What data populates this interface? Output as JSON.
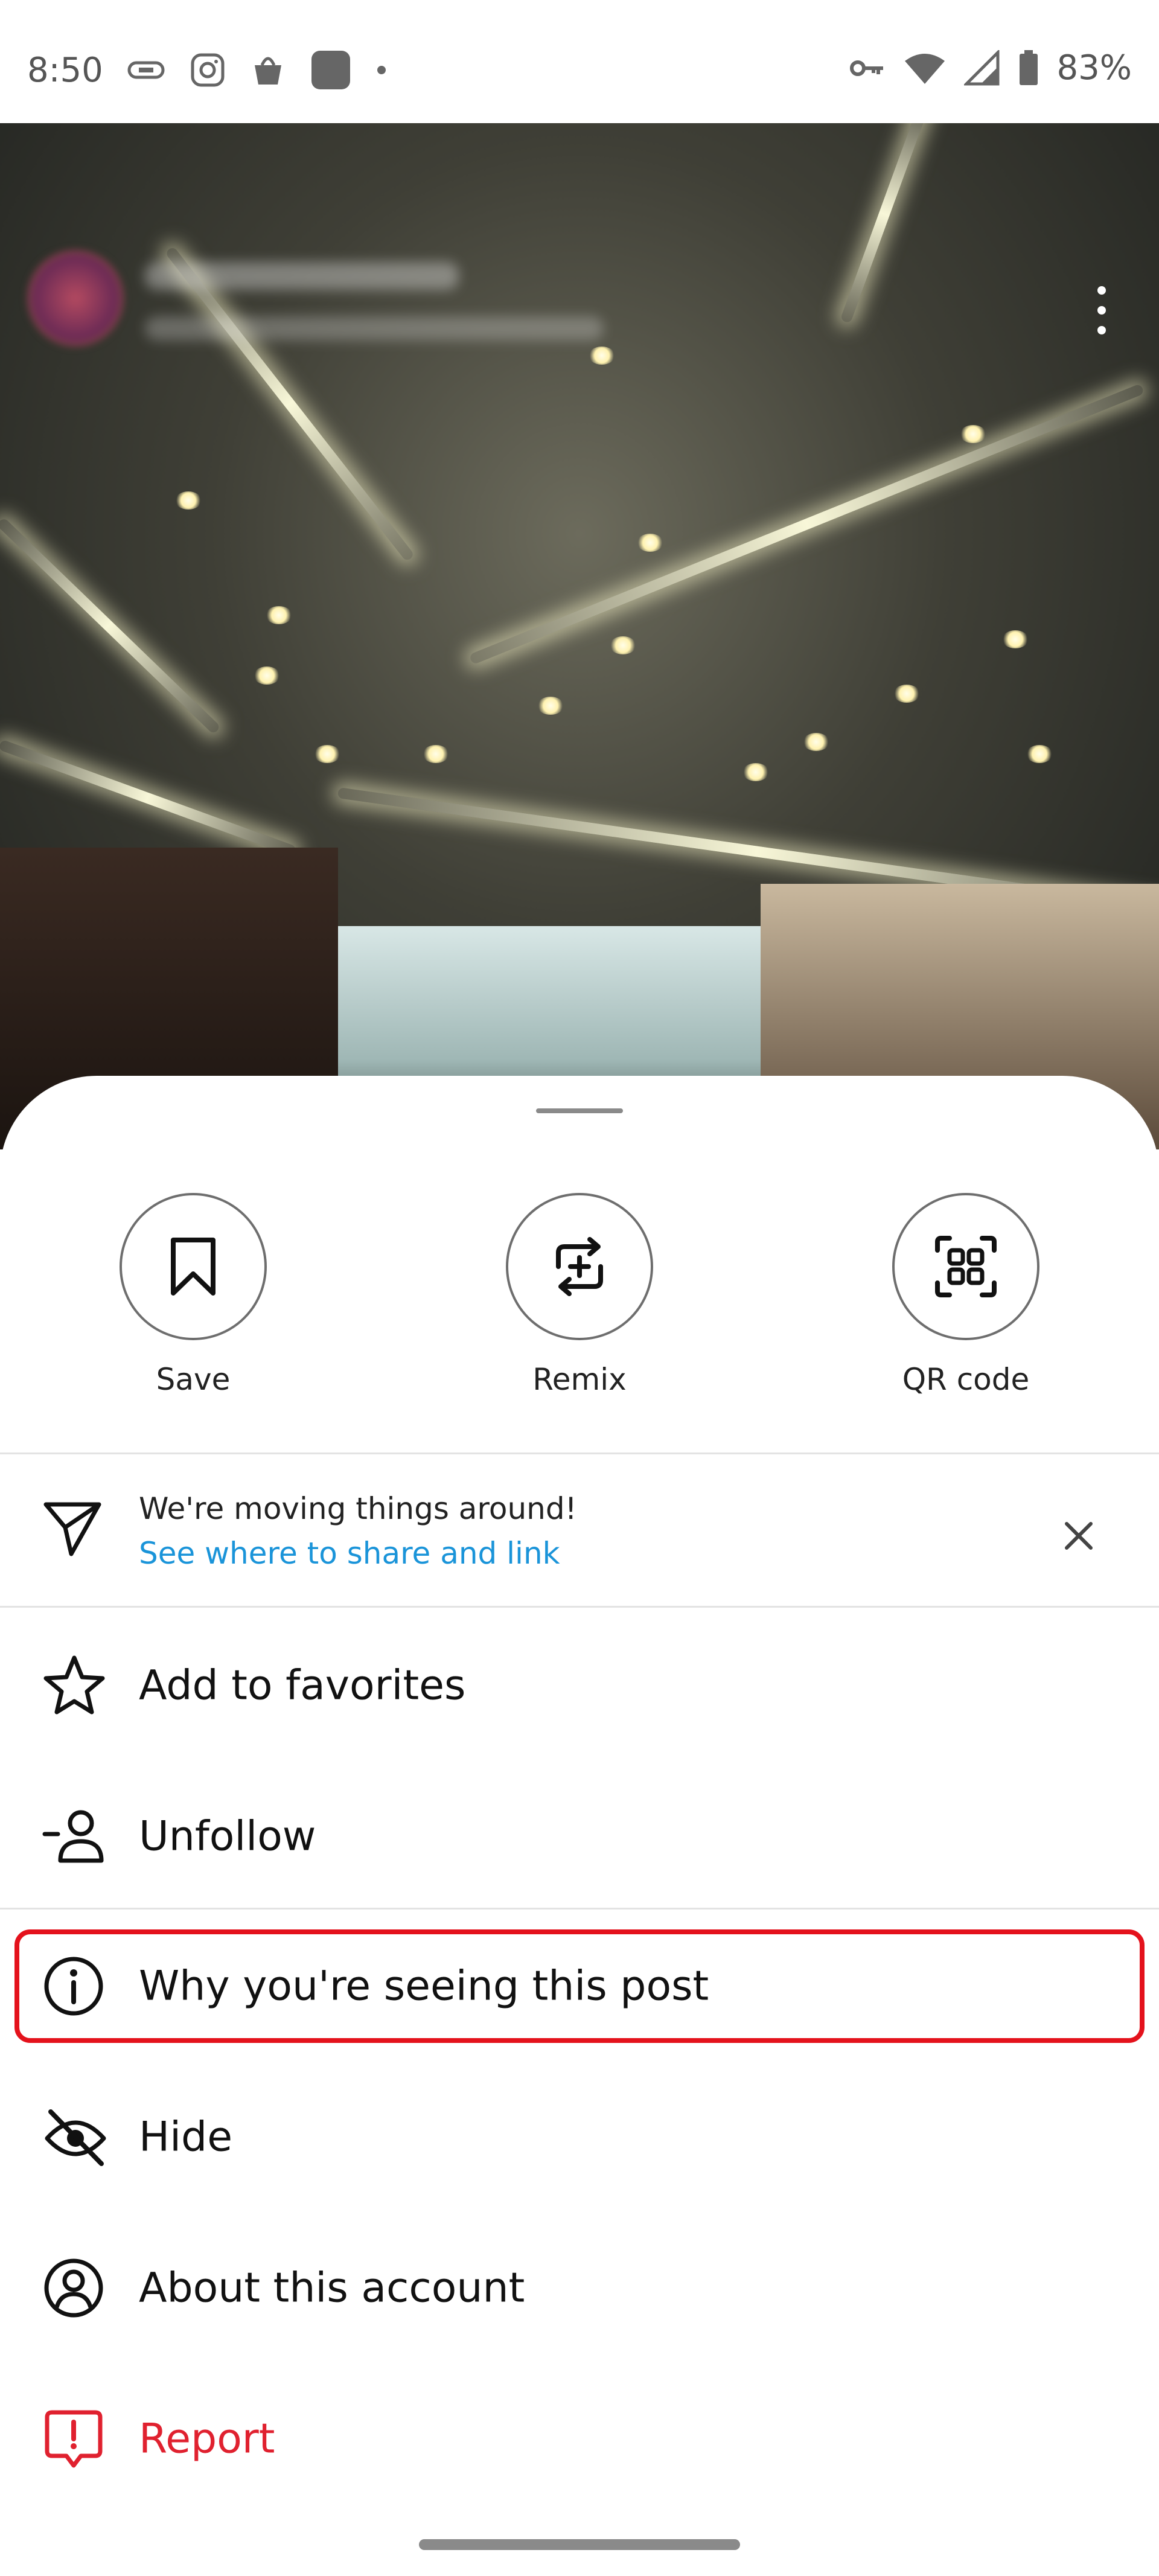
{
  "status_bar": {
    "time": "8:50",
    "battery": "83%",
    "left_icons": [
      "vpn-link-icon",
      "instagram-icon",
      "shopping-bag-icon",
      "app-square-icon",
      "dot-icon"
    ],
    "right_icons": [
      "key-icon",
      "wifi-icon",
      "signal-icon",
      "battery-icon"
    ]
  },
  "post": {
    "more_icon": "more-vertical-icon"
  },
  "sheet": {
    "quick_actions": [
      {
        "label": "Save",
        "icon": "bookmark-icon"
      },
      {
        "label": "Remix",
        "icon": "remix-icon"
      },
      {
        "label": "QR code",
        "icon": "qr-code-icon"
      }
    ],
    "notice": {
      "title": "We're moving things around!",
      "link": "See where to share and link",
      "icon": "send-icon",
      "close_icon": "close-icon"
    },
    "menu": [
      {
        "label": "Add to favorites",
        "icon": "star-icon"
      },
      {
        "label": "Unfollow",
        "icon": "unfollow-user-icon"
      },
      {
        "label": "Why you're seeing this post",
        "icon": "info-icon"
      },
      {
        "label": "Hide",
        "icon": "eye-off-icon"
      },
      {
        "label": "About this account",
        "icon": "account-circle-icon"
      },
      {
        "label": "Report",
        "icon": "report-icon"
      }
    ]
  },
  "colors": {
    "link": "#1a94d9",
    "report": "#e0212f",
    "highlight": "#e4121c"
  }
}
